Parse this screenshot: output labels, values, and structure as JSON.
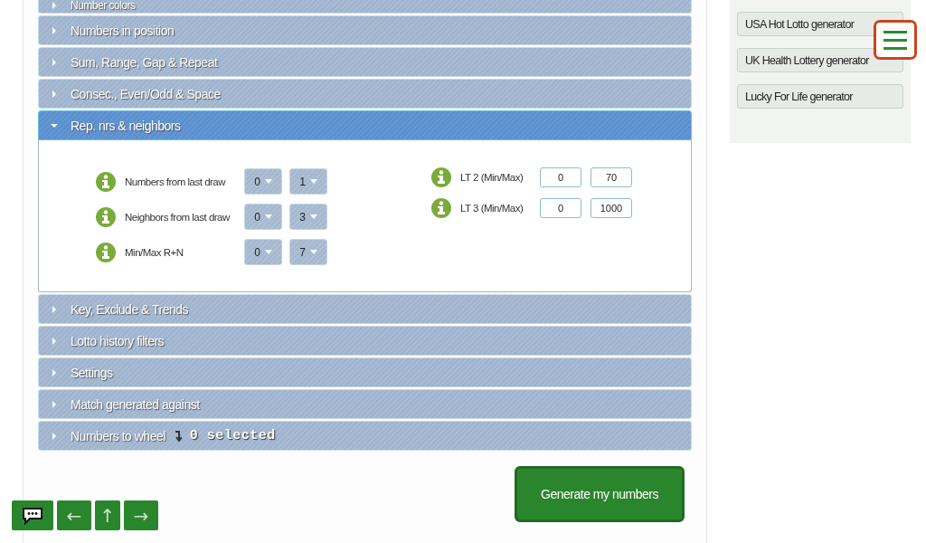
{
  "accordion": [
    {
      "title": "Number colors",
      "expanded": false
    },
    {
      "title": "Numbers in position",
      "expanded": false
    },
    {
      "title": "Sum, Range, Gap & Repeat",
      "expanded": false
    },
    {
      "title": "Consec., Even/Odd & Space",
      "expanded": false
    },
    {
      "title": "Rep. nrs & neighbors",
      "expanded": true
    },
    {
      "title": "Key, Exclude & Trends",
      "expanded": false
    },
    {
      "title": "Lotto history filters",
      "expanded": false
    },
    {
      "title": "Settings",
      "expanded": false
    },
    {
      "title": "Match generated against",
      "expanded": false
    },
    {
      "title": "Numbers to wheel",
      "expanded": false,
      "count": "0 selected"
    }
  ],
  "panel": {
    "dropdown_rows": [
      {
        "label": "Numbers from last draw",
        "min": "0",
        "max": "1"
      },
      {
        "label": "Neighbors from last draw",
        "min": "0",
        "max": "3"
      },
      {
        "label": "Min/Max R+N",
        "min": "0",
        "max": "7"
      }
    ],
    "input_rows": [
      {
        "label": "LT 2 (Min/Max)",
        "min": "0",
        "max": "70"
      },
      {
        "label": "LT 3 (Min/Max)",
        "min": "0",
        "max": "1000"
      }
    ]
  },
  "generate_button": "Generate my numbers",
  "sidebar": {
    "links": [
      "USA Hot Lotto generator",
      "UK Health Lottery generator",
      "Lucky For Life generator"
    ]
  },
  "nav_buttons": [
    "←",
    "↑",
    "→"
  ]
}
